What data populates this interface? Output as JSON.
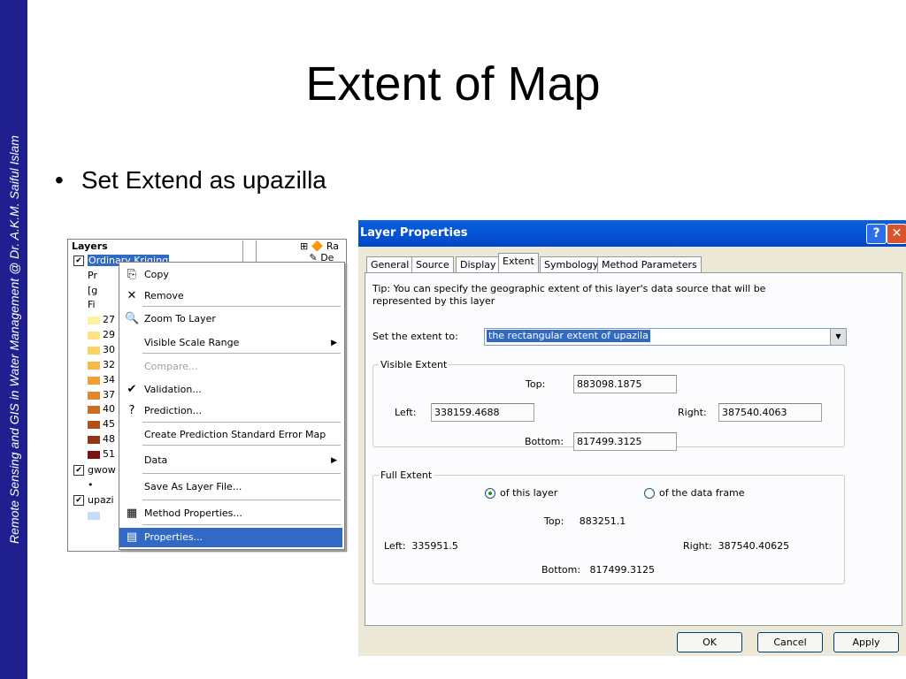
{
  "sidebar": {
    "text": "Remote Sensing and GIS in Water Management  @ Dr. A.K.M. Saiful Islam"
  },
  "slide": {
    "title": "Extent of Map",
    "bullet": "Set Extend as upazilla"
  },
  "toc": {
    "header": "Layers",
    "right_col": [
      "Ra",
      "De"
    ],
    "rows": [
      {
        "text": "Ordinary Kriging",
        "checked": true,
        "selected": true
      },
      {
        "text": "Pr"
      },
      {
        "text": "[g"
      },
      {
        "text": "Fi"
      },
      {
        "text": "27",
        "swatch": "#fef3a3"
      },
      {
        "text": "29",
        "swatch": "#fde480"
      },
      {
        "text": "30",
        "swatch": "#fbd35f"
      },
      {
        "text": "32",
        "swatch": "#f7bb45"
      },
      {
        "text": "34",
        "swatch": "#f0a030"
      },
      {
        "text": "37",
        "swatch": "#e28828"
      },
      {
        "text": "40",
        "swatch": "#cd6e20"
      },
      {
        "text": "45",
        "swatch": "#b0521a"
      },
      {
        "text": "48",
        "swatch": "#923616"
      },
      {
        "text": "51",
        "swatch": "#7a1414"
      },
      {
        "text": "gwow",
        "checked": true
      },
      {
        "text": "•"
      },
      {
        "text": "upazi",
        "checked": true
      },
      {
        "text": "",
        "swatch": "#c6dcf4"
      }
    ]
  },
  "context_menu": {
    "items": [
      {
        "label": "Copy",
        "icon": "copy-icon",
        "glyph": "⎘"
      },
      {
        "label": "Remove",
        "icon": "remove-icon",
        "glyph": "✕"
      },
      {
        "label": "Zoom To Layer",
        "icon": "zoom-to-layer-icon",
        "glyph": "🔍"
      },
      {
        "label": "Visible Scale Range",
        "submenu": true
      },
      {
        "label": "Compare...",
        "disabled": true
      },
      {
        "label": "Validation...",
        "icon": "validation-icon",
        "glyph": "✔"
      },
      {
        "label": "Prediction...",
        "icon": "prediction-icon",
        "glyph": "?"
      },
      {
        "label": "Create Prediction Standard Error Map"
      },
      {
        "label": "Data",
        "submenu": true
      },
      {
        "label": "Save As Layer File..."
      },
      {
        "label": "Method Properties...",
        "icon": "method-properties-icon",
        "glyph": "▦"
      },
      {
        "label": "Properties...",
        "icon": "properties-icon",
        "glyph": "▤",
        "highlighted": true
      }
    ]
  },
  "dialog": {
    "title": "Layer Properties",
    "help_label": "?",
    "close_label": "✕",
    "tabs": [
      "General",
      "Source",
      "Display",
      "Extent",
      "Symbology",
      "Method Parameters"
    ],
    "active_tab": "Extent",
    "tip_line1": "Tip:  You can specify the geographic extent of this layer's data source that will be",
    "tip_line2": "represented by this layer",
    "set_extent_label": "Set the extent to:",
    "set_extent_value": "the rectangular extent of upazila",
    "visible_extent": {
      "title": "Visible Extent",
      "top_label": "Top:",
      "top": "883098.1875",
      "left_label": "Left:",
      "left": "338159.4688",
      "right_label": "Right:",
      "right": "387540.4063",
      "bottom_label": "Bottom:",
      "bottom": "817499.3125"
    },
    "full_extent": {
      "title": "Full Extent",
      "radio_layer": "of this layer",
      "radio_frame": "of the data frame",
      "top": "Top:     883251.1",
      "left": "Left:  335951.5",
      "right": "Right:  387540.40625",
      "bottom": "Bottom:   817499.3125"
    },
    "buttons": {
      "ok": "OK",
      "cancel": "Cancel",
      "apply": "Apply"
    }
  }
}
